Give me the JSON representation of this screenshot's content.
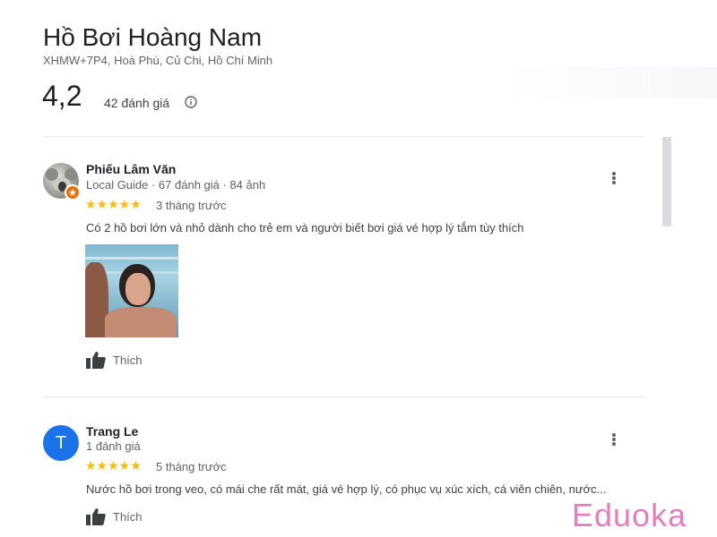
{
  "place": {
    "name": "Hồ Bơi Hoàng Nam",
    "address": "XHMW+7P4, Hoà Phú, Củ Chi, Hồ Chí Minh",
    "rating": "4,2",
    "review_count": "42 đánh giá"
  },
  "reviews": [
    {
      "author": "Phiếu Lâm Văn",
      "meta": "Local Guide · 67 đánh giá · 84 ảnh",
      "stars": 5,
      "stars_text": "★★★★★",
      "time": "3 tháng trước",
      "text": "Có 2 hồ bơi lớn và nhỏ dành cho trẻ em và người biết bơi giá vé hợp lý tắm tùy thích",
      "like_label": "Thích"
    },
    {
      "author": "Trang Le",
      "avatar_letter": "T",
      "meta": "1 đánh giá",
      "stars": 5,
      "stars_text": "★★★★★",
      "time": "5 tháng trước",
      "text": "Nước hồ bơi trong veo, có mái che rất mát, giá vé hợp lý, có phục vụ xúc xích, cá viên chiên, nước...",
      "like_label": "Thích"
    }
  ],
  "watermark": "Eduoka",
  "colors": {
    "star": "#fbbc04",
    "avatar_blue": "#1a73e8",
    "local_guide_badge": "#e8710a",
    "watermark": "#e27fbf"
  }
}
